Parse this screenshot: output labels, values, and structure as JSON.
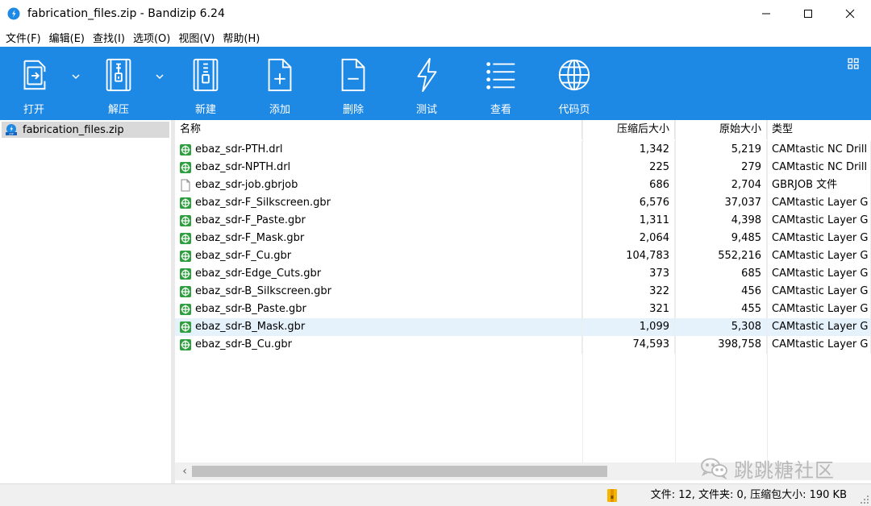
{
  "window": {
    "title": "fabrication_files.zip - Bandizip 6.24"
  },
  "menu": [
    "文件(F)",
    "编辑(E)",
    "查找(I)",
    "选项(O)",
    "视图(V)",
    "帮助(H)"
  ],
  "toolbar": {
    "buttons": [
      {
        "label": "打开",
        "icon": "open-icon"
      },
      {
        "label": "解压",
        "icon": "extract-icon"
      },
      {
        "label": "新建",
        "icon": "new-archive-icon"
      },
      {
        "label": "添加",
        "icon": "add-file-icon"
      },
      {
        "label": "删除",
        "icon": "delete-file-icon"
      },
      {
        "label": "测试",
        "icon": "test-lightning-icon"
      },
      {
        "label": "查看",
        "icon": "view-list-icon"
      },
      {
        "label": "代码页",
        "icon": "globe-icon"
      }
    ],
    "background": "#1e88e5"
  },
  "tree": {
    "root": "fabrication_files.zip"
  },
  "list": {
    "columns": [
      "名称",
      "压缩后大小",
      "原始大小",
      "类型"
    ],
    "rows": [
      {
        "name": "ebaz_sdr-PTH.drl",
        "compressed": "1,342",
        "original": "5,219",
        "type": "CAMtastic NC Drill",
        "icon": "gerber-icon"
      },
      {
        "name": "ebaz_sdr-NPTH.drl",
        "compressed": "225",
        "original": "279",
        "type": "CAMtastic NC Drill",
        "icon": "gerber-icon"
      },
      {
        "name": "ebaz_sdr-job.gbrjob",
        "compressed": "686",
        "original": "2,704",
        "type": "GBRJOB 文件",
        "icon": "blank-file-icon"
      },
      {
        "name": "ebaz_sdr-F_Silkscreen.gbr",
        "compressed": "6,576",
        "original": "37,037",
        "type": "CAMtastic Layer G",
        "icon": "gerber-icon"
      },
      {
        "name": "ebaz_sdr-F_Paste.gbr",
        "compressed": "1,311",
        "original": "4,398",
        "type": "CAMtastic Layer G",
        "icon": "gerber-icon"
      },
      {
        "name": "ebaz_sdr-F_Mask.gbr",
        "compressed": "2,064",
        "original": "9,485",
        "type": "CAMtastic Layer G",
        "icon": "gerber-icon"
      },
      {
        "name": "ebaz_sdr-F_Cu.gbr",
        "compressed": "104,783",
        "original": "552,216",
        "type": "CAMtastic Layer G",
        "icon": "gerber-icon"
      },
      {
        "name": "ebaz_sdr-Edge_Cuts.gbr",
        "compressed": "373",
        "original": "685",
        "type": "CAMtastic Layer G",
        "icon": "gerber-icon"
      },
      {
        "name": "ebaz_sdr-B_Silkscreen.gbr",
        "compressed": "322",
        "original": "456",
        "type": "CAMtastic Layer G",
        "icon": "gerber-icon"
      },
      {
        "name": "ebaz_sdr-B_Paste.gbr",
        "compressed": "321",
        "original": "455",
        "type": "CAMtastic Layer G",
        "icon": "gerber-icon"
      },
      {
        "name": "ebaz_sdr-B_Mask.gbr",
        "compressed": "1,099",
        "original": "5,308",
        "type": "CAMtastic Layer G",
        "icon": "gerber-icon",
        "selected": true
      },
      {
        "name": "ebaz_sdr-B_Cu.gbr",
        "compressed": "74,593",
        "original": "398,758",
        "type": "CAMtastic Layer G",
        "icon": "gerber-icon"
      }
    ]
  },
  "status": {
    "text": "文件: 12, 文件夹: 0, 压缩包大小: 190 KB"
  },
  "watermark": {
    "text": "跳跳糖社区"
  }
}
